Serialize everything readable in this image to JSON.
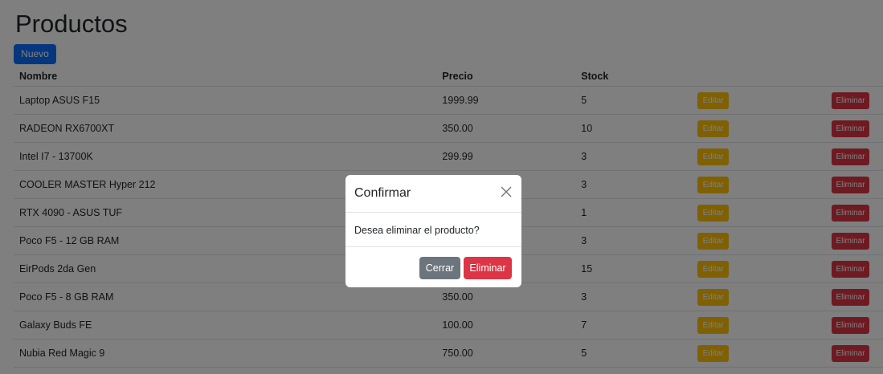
{
  "page": {
    "title": "Productos",
    "new_button": "Nuevo"
  },
  "table": {
    "headers": {
      "nombre": "Nombre",
      "precio": "Precio",
      "stock": "Stock"
    },
    "edit_label": "Editar",
    "delete_label": "Eliminar",
    "rows": [
      {
        "nombre": "Laptop ASUS F15",
        "precio": "1999.99",
        "stock": "5"
      },
      {
        "nombre": "RADEON RX6700XT",
        "precio": "350.00",
        "stock": "10"
      },
      {
        "nombre": "Intel I7 - 13700K",
        "precio": "299.99",
        "stock": "3"
      },
      {
        "nombre": "COOLER MASTER Hyper 212",
        "precio": "",
        "stock": "3"
      },
      {
        "nombre": "RTX 4090 - ASUS TUF",
        "precio": "",
        "stock": "1"
      },
      {
        "nombre": "Poco F5 - 12 GB RAM",
        "precio": "",
        "stock": "3"
      },
      {
        "nombre": "EirPods 2da Gen",
        "precio": "",
        "stock": "15"
      },
      {
        "nombre": "Poco F5 - 8 GB RAM",
        "precio": "350.00",
        "stock": "3"
      },
      {
        "nombre": "Galaxy Buds FE",
        "precio": "100.00",
        "stock": "7"
      },
      {
        "nombre": "Nubia Red Magic 9",
        "precio": "750.00",
        "stock": "5"
      }
    ]
  },
  "modal": {
    "title": "Confirmar",
    "message": "Desea eliminar el producto?",
    "cancel_label": "Cerrar",
    "confirm_label": "Eliminar"
  },
  "colors": {
    "primary": "#0d6efd",
    "warning": "#ffc107",
    "danger": "#dc3545",
    "secondary": "#6c757d"
  },
  "icons": {
    "close": "close-icon"
  }
}
